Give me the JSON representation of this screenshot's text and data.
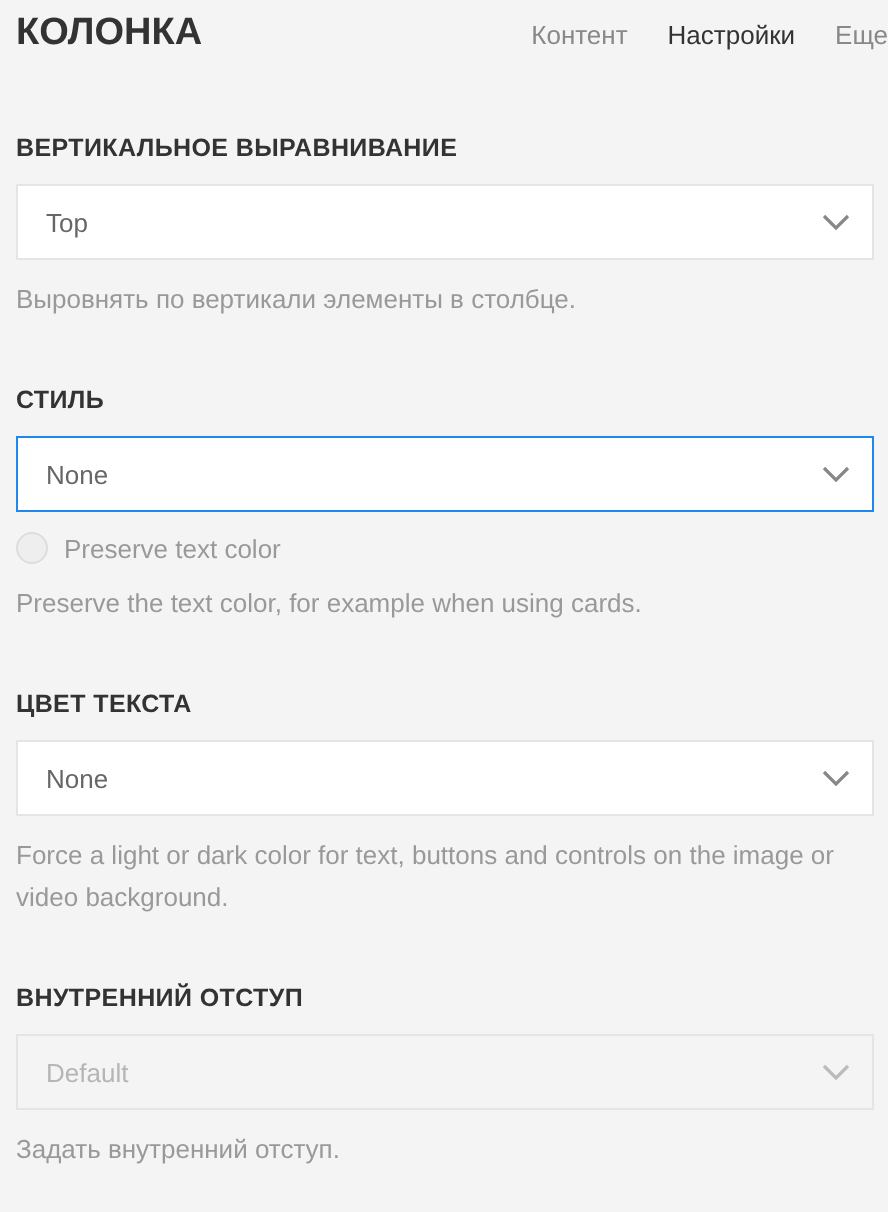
{
  "title": "КОЛОНКА",
  "tabs": [
    {
      "label": "Контент",
      "selected": false
    },
    {
      "label": "Настройки",
      "selected": true
    },
    {
      "label": "Еще",
      "selected": false
    }
  ],
  "sections": [
    {
      "label": "ВЕРТИКАЛЬНОЕ ВЫРАВНИВАНИЕ",
      "select": {
        "value": "Top",
        "focused": false,
        "disabled": false
      },
      "help": "Выровнять по вертикали элементы в столбце."
    },
    {
      "label": "СТИЛЬ",
      "select": {
        "value": "None",
        "focused": true,
        "disabled": false
      },
      "checkbox": {
        "label": "Preserve text color",
        "checked": false
      },
      "help": "Preserve the text color, for example when using cards."
    },
    {
      "label": "ЦВЕТ ТЕКСТА",
      "select": {
        "value": "None",
        "focused": false,
        "disabled": false
      },
      "help": "Force a light or dark color for text, buttons and controls on the image or video background."
    },
    {
      "label": "ВНУТРЕННИЙ ОТСТУП",
      "select": {
        "value": "Default",
        "focused": false,
        "disabled": true
      },
      "help": "Задать внутренний отступ."
    }
  ]
}
